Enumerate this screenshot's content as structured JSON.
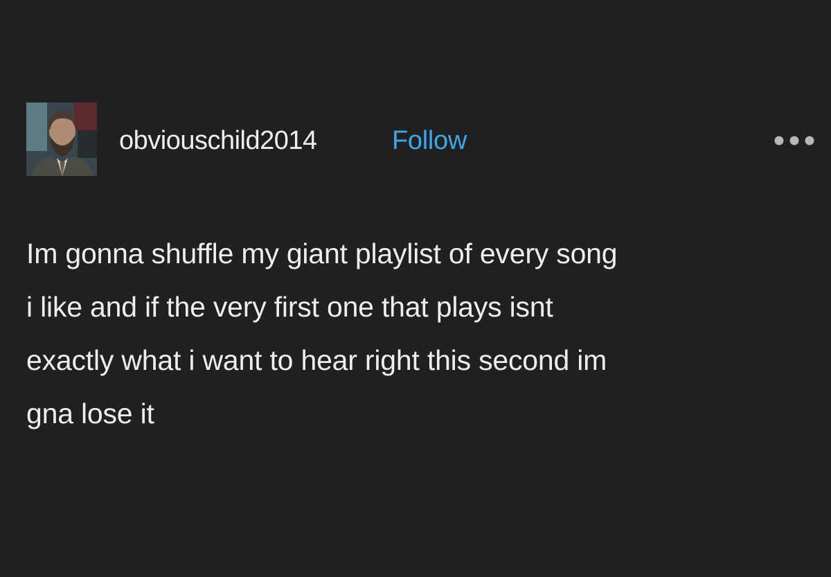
{
  "post": {
    "username": "obviouschild2014",
    "follow_label": "Follow",
    "more_icon": "more-options-icon",
    "body_lines": [
      "Im gonna shuffle my giant playlist of every song",
      "i like and if the very first one that plays isnt",
      "exactly what i want to hear right this second im",
      "gna lose it"
    ]
  },
  "colors": {
    "background": "#202022",
    "text": "#efeeeb",
    "accent": "#3ea6e6",
    "muted_icon": "#b8b8b8"
  }
}
